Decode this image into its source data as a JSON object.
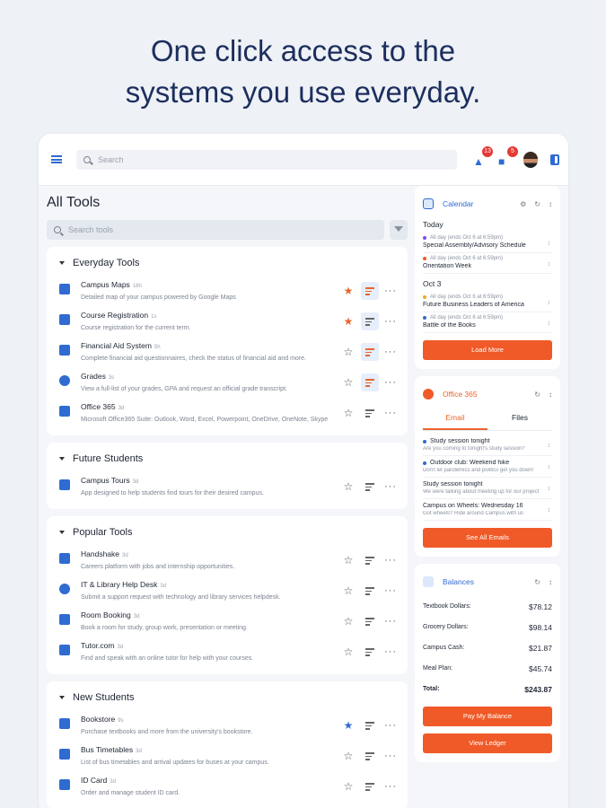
{
  "headline": {
    "line1": "One click access to the",
    "line2": "systems you use everyday."
  },
  "topbar": {
    "search_placeholder": "Search",
    "notifications_count": "13",
    "messages_count": "5"
  },
  "main": {
    "title": "All Tools",
    "search_placeholder": "Search tools",
    "sections": [
      {
        "title": "Everyday Tools",
        "tools": [
          {
            "name": "Campus Maps",
            "age": "18h",
            "desc": "Detailed map of your campus powered by Google Maps"
          },
          {
            "name": "Course Registration",
            "age": "1s",
            "desc": "Course registration for the current term."
          },
          {
            "name": "Financial Aid System",
            "age": "5h",
            "desc": "Complete financial aid questionnaires, check the status of financial aid and more."
          },
          {
            "name": "Grades",
            "age": "3s",
            "desc": "View a full-list of your grades, GPA and request an official grade transcript."
          },
          {
            "name": "Office 365",
            "age": "3d",
            "desc": "Microsoft Office365 Suite: Outlook, Word, Excel, Powerpoint, OneDrive, OneNote, Skype"
          }
        ]
      },
      {
        "title": "Future Students",
        "tools": [
          {
            "name": "Campus Tours",
            "age": "3d",
            "desc": "App designed to help students find tours for their desired campus."
          }
        ]
      },
      {
        "title": "Popular Tools",
        "tools": [
          {
            "name": "Handshake",
            "age": "3d",
            "desc": "Careers platform with jobs and internship opportunities."
          },
          {
            "name": "IT & Library Help Desk",
            "age": "3d",
            "desc": "Submit a support request with technology and library services helpdesk."
          },
          {
            "name": "Room Booking",
            "age": "3d",
            "desc": "Book a room for study, group work, presentation or meeting."
          },
          {
            "name": "Tutor.com",
            "age": "3d",
            "desc": "Find and speak with an online tutor for help with your courses."
          }
        ]
      },
      {
        "title": "New Students",
        "tools": [
          {
            "name": "Bookstore",
            "age": "9s",
            "desc": "Purchase textbooks and more from the university's bookstore."
          },
          {
            "name": "Bus Timetables",
            "age": "3d",
            "desc": "List of bus timetables and arrival updates for buses at your campus."
          },
          {
            "name": "ID Card",
            "age": "3d",
            "desc": "Order and manage student ID card."
          }
        ]
      }
    ]
  },
  "calendar": {
    "title": "Calendar",
    "today_label": "Today",
    "oct3_label": "Oct 3",
    "events": [
      {
        "meta": "All day (ends Oct 6 at 6:59pm)",
        "title": "Special Assembly/Advisory Schedule",
        "color": "#7c4dff"
      },
      {
        "meta": "All day (ends Oct 6 at 6:59pm)",
        "title": "Orientation Week",
        "color": "#f05a28"
      },
      {
        "meta": "All day (ends Oct 6 at 6:59pm)",
        "title": "Future Business Leaders of America",
        "color": "#f5a623"
      },
      {
        "meta": "All day (ends Oct 6 at 6:59pm)",
        "title": "Battle of the Books",
        "color": "#2f6bd1"
      }
    ],
    "button": "Load More"
  },
  "office365": {
    "title": "Office 365",
    "tab_email": "Email",
    "tab_files": "Files",
    "emails": [
      {
        "subject": "Study session tonight",
        "preview": "Are you coming to tonight's study session?",
        "unread": true
      },
      {
        "subject": "Outdoor club: Weekend hike",
        "preview": "Don't let pandemics and politics get you down!",
        "unread": true
      },
      {
        "subject": "Study session tonight",
        "preview": "We were talking about meeting up for our project",
        "unread": false
      },
      {
        "subject": "Campus on Wheels: Wednesday 16",
        "preview": "Got wheels? Ride around Campus with us",
        "unread": false
      }
    ],
    "button": "See All Emails"
  },
  "balances": {
    "title": "Balances",
    "rows": [
      {
        "label": "Textbook Dollars:",
        "value": "$78.12"
      },
      {
        "label": "Grocery Dollars:",
        "value": "$98.14"
      },
      {
        "label": "Campus Cash:",
        "value": "$21.87"
      },
      {
        "label": "Meal Plan:",
        "value": "$45.74"
      },
      {
        "label": "Total:",
        "value": "$243.87"
      }
    ],
    "button_pay": "Pay My Balance",
    "button_ledger": "View Ledger"
  }
}
